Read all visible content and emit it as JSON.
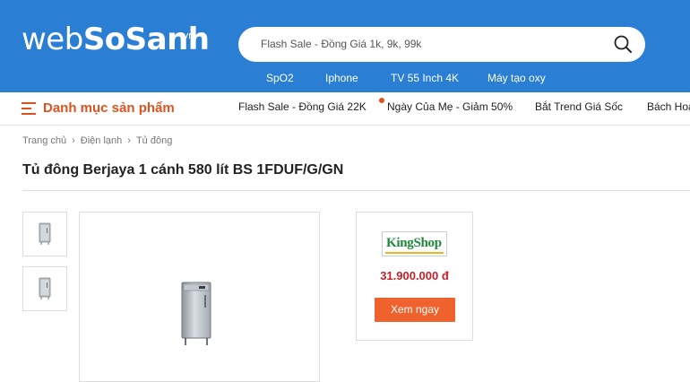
{
  "header": {
    "logo": {
      "part1": "web",
      "part2": "SoSanh",
      "suffix": "vn"
    },
    "search": {
      "placeholder": "Flash Sale - Đồng Giá 1k, 9k, 99k",
      "icon": "search-icon"
    },
    "quick_links": [
      "SpO2",
      "Iphone",
      "TV 55 Inch 4K",
      "Máy tạo oxy"
    ]
  },
  "nav": {
    "menu_label": "Danh mục sản phẩm",
    "menu_icon": "hamburger-menu-icon",
    "links": [
      "Flash Sale - Đồng Giá 22K",
      "Ngày Của Mẹ - Giảm 50%",
      "Bắt Trend Giá Sốc",
      "Bách Hoá"
    ],
    "accent_color": "#e0521d"
  },
  "breadcrumb": [
    "Trang chủ",
    "Điện lạnh",
    "Tủ đông"
  ],
  "product": {
    "title": "Tủ đông Berjaya 1 cánh 580 lít BS 1FDUF/G/GN"
  },
  "offer": {
    "shop_name": "KingShop",
    "price": "31.900.000 đ",
    "button_label": "Xem ngay"
  },
  "colors": {
    "header_bg": "#2a7fd4",
    "price": "#c8202a",
    "button": "#f0622d"
  }
}
